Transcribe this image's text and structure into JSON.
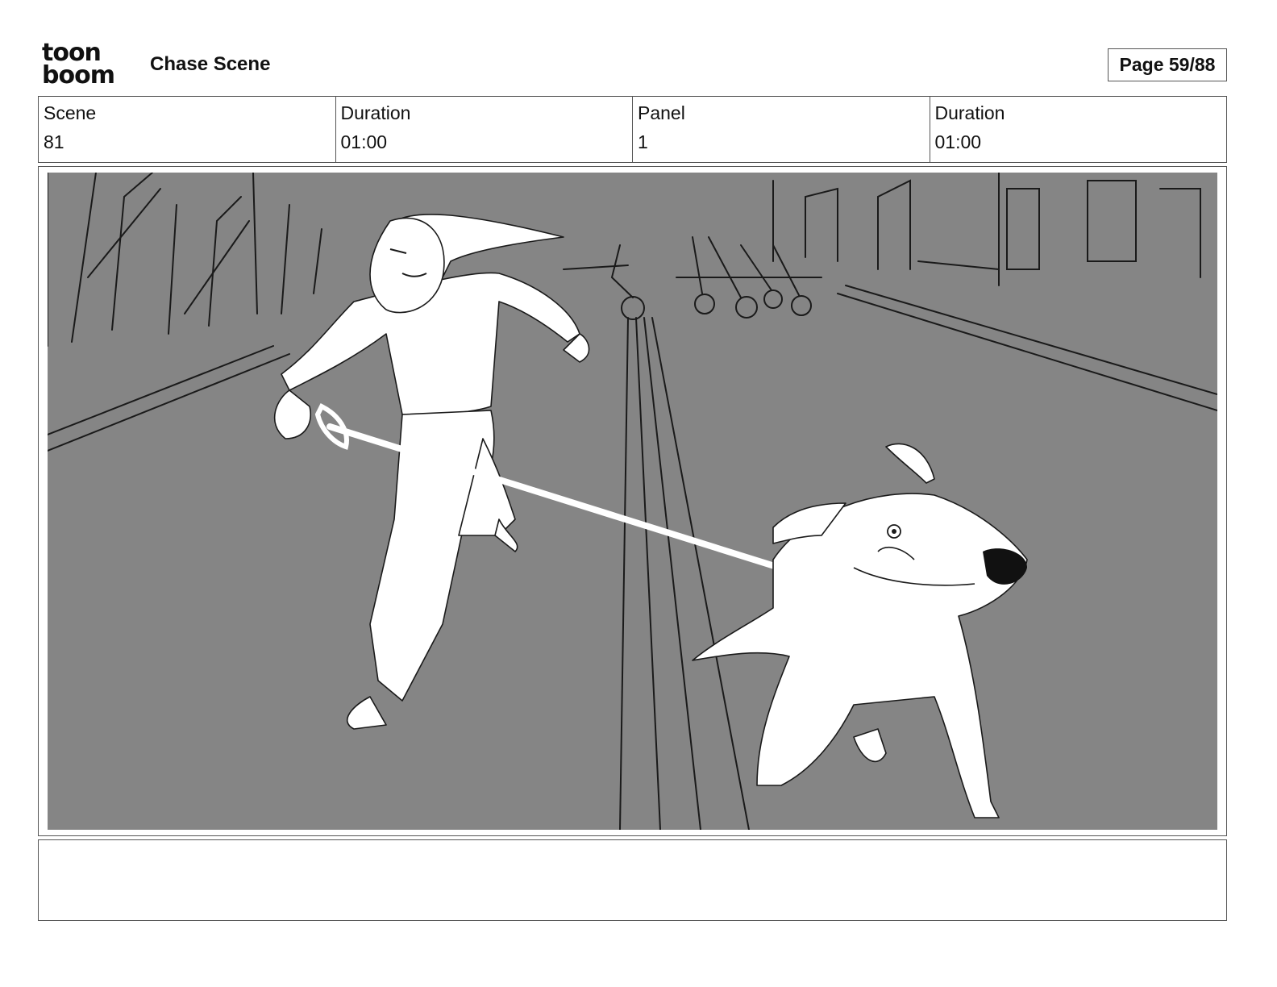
{
  "header": {
    "logo_line1": "toon",
    "logo_line2": "boom",
    "title": "Chase Scene",
    "page_label": "Page 59/88"
  },
  "info": {
    "scene_label": "Scene",
    "scene_value": "81",
    "scene_duration_label": "Duration",
    "scene_duration_value": "01:00",
    "panel_label": "Panel",
    "panel_value": "1",
    "panel_duration_label": "Duration",
    "panel_duration_value": "01:00"
  },
  "panel": {
    "background_color": "#858585",
    "sketch_color": "#ffffff",
    "line_color": "#1a1a1a"
  },
  "notes": {
    "text": ""
  }
}
